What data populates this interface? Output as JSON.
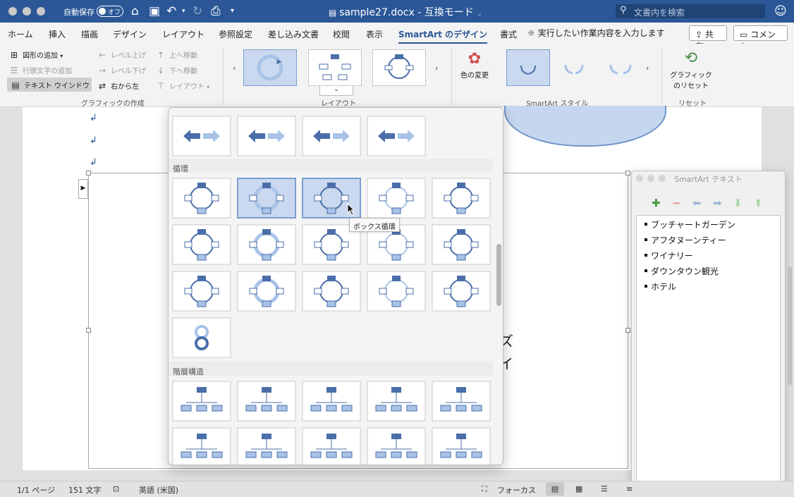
{
  "titlebar": {
    "autosave_label": "自動保存",
    "autosave_state": "オフ",
    "document_title": "sample27.docx",
    "separator": "-",
    "mode": "互換モード",
    "search_placeholder": "文書内を検索"
  },
  "tabs": [
    {
      "label": "ホーム"
    },
    {
      "label": "挿入"
    },
    {
      "label": "描画"
    },
    {
      "label": "デザイン"
    },
    {
      "label": "レイアウト"
    },
    {
      "label": "参照設定"
    },
    {
      "label": "差し込み文書"
    },
    {
      "label": "校閲"
    },
    {
      "label": "表示"
    },
    {
      "label": "SmartArt のデザイン"
    },
    {
      "label": "書式"
    }
  ],
  "tell_me": "実行したい作業内容を入力します",
  "share_label": "共有",
  "comment_label": "コメント",
  "ribbon": {
    "create_graphic": {
      "add_shape": "図形の追加",
      "add_bullet": "行頭文字の追加",
      "text_window": "テキスト ウインドウ",
      "promote": "レベル上げ",
      "demote": "レベル下げ",
      "right_to_left": "右から左",
      "move_up": "上へ移動",
      "move_down": "下へ移動",
      "layout": "レイアウト",
      "group_label": "グラフィックの作成"
    },
    "layouts_group_label": "レイアウト",
    "change_colors": "色の変更",
    "styles_group_label": "SmartArt スタイル",
    "reset_graphic": "グラフィック\nのリセット",
    "reset_graphic_l1": "グラフィック",
    "reset_graphic_l2": "のリセット",
    "reset_group_label": "リセット"
  },
  "gallery": {
    "section_cycle": "循環",
    "section_hierarchy": "階層構造",
    "tooltip": "ボックス循環"
  },
  "document": {
    "doc_chars": [
      "ズ",
      "イ"
    ]
  },
  "text_pane": {
    "title": "SmartArt テキスト",
    "items": [
      "ブッチャートガーデン",
      "アフタヌーンティー",
      "ワイナリー",
      "ダウンタウン観光",
      "ホテル"
    ]
  },
  "status": {
    "page": "1/1 ページ",
    "words": "151 文字",
    "language": "英語 (米国)",
    "focus": "フォーカス"
  },
  "colors": {
    "title_bar": "#2b5797",
    "accent": "#2b5797",
    "smartart_fill": "#4a6ea9",
    "smartart_light": "#a9c3e8"
  },
  "icons": [
    "home-icon",
    "save-icon",
    "undo-icon",
    "redo-icon",
    "print-icon",
    "search-icon",
    "smiley-icon",
    "lightbulb-icon",
    "share-icon",
    "comment-icon",
    "add-shape-icon",
    "add-bullet-icon",
    "text-window-icon",
    "promote-icon",
    "demote-icon",
    "right-to-left-icon",
    "move-up-icon",
    "move-down-icon",
    "layout-icon",
    "palette-icon",
    "reset-icon",
    "add-icon",
    "remove-icon",
    "arrow-left-icon",
    "arrow-right-icon",
    "arrow-down-icon",
    "arrow-up-icon",
    "focus-icon",
    "print-layout-icon",
    "web-layout-icon",
    "outline-icon",
    "draft-icon"
  ]
}
